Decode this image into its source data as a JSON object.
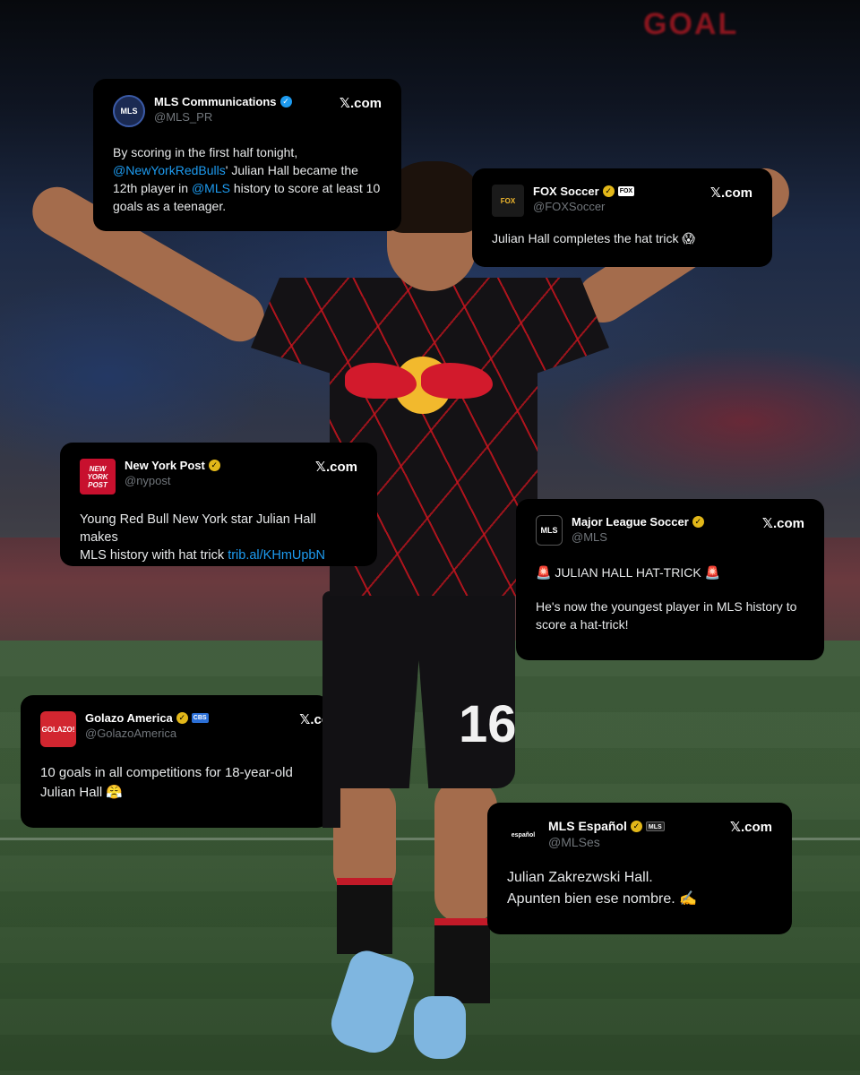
{
  "background": {
    "signs": [
      "GOAL"
    ],
    "jersey_number": "16"
  },
  "tweets": [
    {
      "name": "MLS Communications",
      "handle": "@MLS_PR",
      "verified": "blue",
      "site": "com",
      "avatar_text": "MLS",
      "avatar_color": "#1b2a52",
      "lines": [
        {
          "parts": [
            {
              "t": "By scoring in the first half tonight, "
            }
          ]
        },
        {
          "parts": [
            {
              "t": "@NewYorkRedBulls",
              "link": true
            },
            {
              "t": "' Julian Hall became the"
            }
          ]
        },
        {
          "parts": [
            {
              "t": "12th player in "
            },
            {
              "t": "@MLS",
              "link": true
            },
            {
              "t": " history to score at least 10"
            }
          ]
        },
        {
          "parts": [
            {
              "t": "goals as a teenager."
            }
          ]
        }
      ]
    },
    {
      "name": "FOX Soccer",
      "handle": "@FOXSoccer",
      "verified": "gold",
      "badge": "FOX",
      "site": "com",
      "avatar_text": "FOX",
      "avatar_color": "#1a1a1a",
      "lines": [
        {
          "parts": [
            {
              "t": "Julian Hall completes the hat trick 😱"
            }
          ]
        }
      ]
    },
    {
      "name": "New York Post",
      "handle": "@nypost",
      "verified": "gold",
      "site": "com",
      "avatar_text": "NEW YORK POST",
      "avatar_color": "#c8102e",
      "lines": [
        {
          "parts": [
            {
              "t": "Young Red Bull New York star Julian Hall makes"
            }
          ]
        },
        {
          "parts": [
            {
              "t": "MLS history with hat trick "
            },
            {
              "t": "trib.al/KHmUpbN",
              "link": true
            }
          ]
        }
      ]
    },
    {
      "name": "Major League Soccer",
      "handle": "@MLS",
      "verified": "gold",
      "site": "com",
      "avatar_text": "MLS",
      "avatar_color": "#000000",
      "lines": [
        {
          "parts": [
            {
              "t": "🚨 JULIAN HALL HAT-TRICK 🚨"
            }
          ]
        },
        {
          "parts": [
            {
              "t": ""
            }
          ]
        },
        {
          "parts": [
            {
              "t": "He's now the youngest player in MLS history to"
            }
          ]
        },
        {
          "parts": [
            {
              "t": "score a hat-trick!"
            }
          ]
        }
      ]
    },
    {
      "name": "Golazo America",
      "handle": "@GolazoAmerica",
      "verified": "gold",
      "badge": "CBS",
      "site": "co",
      "avatar_text": "GOLAZO!",
      "avatar_color": "#d22630",
      "lines": [
        {
          "parts": [
            {
              "t": "10 goals in all competitions for 18-year-old"
            }
          ]
        },
        {
          "parts": [
            {
              "t": "Julian Hall 😤"
            }
          ]
        }
      ]
    },
    {
      "name": "MLS Español",
      "handle": "@MLSes",
      "verified": "gold",
      "badge": "MLS",
      "site": "com",
      "avatar_text": "español",
      "avatar_color": "#000000",
      "lines": [
        {
          "parts": [
            {
              "t": "Julian Zakrezwski Hall."
            }
          ]
        },
        {
          "parts": [
            {
              "t": "Apunten bien ese nombre. ✍️"
            }
          ]
        }
      ]
    }
  ],
  "ui": {
    "x_mark": "𝕏",
    "check": "✓"
  }
}
